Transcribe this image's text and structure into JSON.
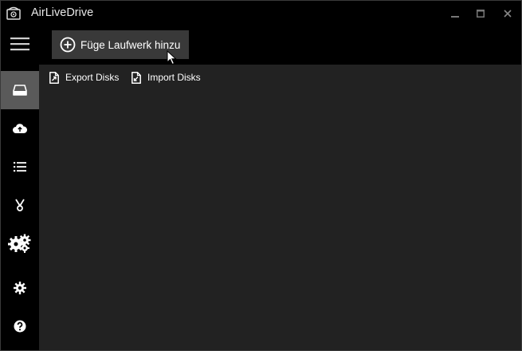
{
  "window": {
    "title": "AirLiveDrive",
    "controls": [
      "minimize-icon",
      "maximize-icon",
      "close-icon"
    ]
  },
  "toolbar": {
    "add_drive_label": "Füge Laufwerk hinzu",
    "menu_icon": "hamburger-icon"
  },
  "actions": {
    "export_label": "Export Disks",
    "import_label": "Import Disks"
  },
  "sidebar": {
    "items": [
      {
        "icon": "drive-icon",
        "active": true
      },
      {
        "icon": "cloud-upload-icon",
        "active": false
      },
      {
        "icon": "list-icon",
        "active": false
      },
      {
        "icon": "scissors-icon",
        "active": false
      },
      {
        "icon": "gears-icon",
        "active": false
      },
      {
        "icon": "settings-icon",
        "active": false
      },
      {
        "icon": "help-icon",
        "active": false
      }
    ]
  },
  "colors": {
    "background": "#000000",
    "panel": "#222222",
    "button": "#393939",
    "active_nav": "#5a5a5a",
    "text": "#ffffff"
  }
}
